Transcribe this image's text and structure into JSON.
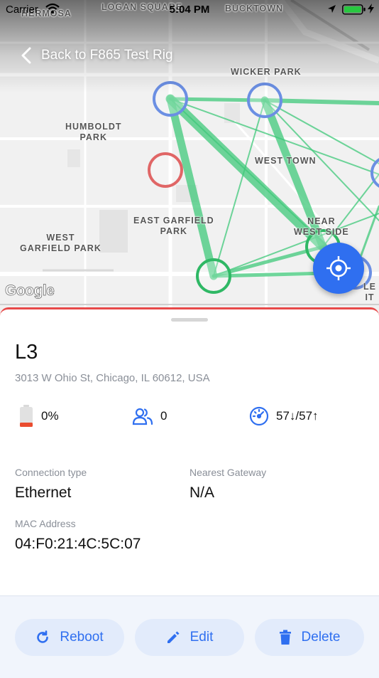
{
  "status_bar": {
    "carrier": "Carrier",
    "time": "5:04 PM"
  },
  "nav": {
    "back_label": "Back to F865 Test Rig"
  },
  "map": {
    "labels": {
      "hermosa": "HERMOSA",
      "logan_square": "LOGAN SQUARE",
      "bucktown": "BUCKTOWN",
      "wicker_park": "WICKER PARK",
      "humboldt_park": "HUMBOLDT\nPARK",
      "west_town": "WEST TOWN",
      "east_garfield_park": "EAST GARFIELD\nPARK",
      "west_garfield_park": "WEST\nGARFIELD PARK",
      "near_west_side": "NEAR\nWEST SIDE",
      "partial": "LE IT"
    },
    "attribution": "Google",
    "colors": {
      "link": "#3fc87a",
      "node_online": "#2fb865",
      "node_selected": "#6b8fe3",
      "node_offline": "#e06666"
    }
  },
  "device": {
    "name": "L3",
    "address": "3013 W Ohio St, Chicago, IL 60612, USA",
    "battery": "0%",
    "clients": "0",
    "speed": "57↓/57↑",
    "connection_type_label": "Connection type",
    "connection_type": "Ethernet",
    "nearest_gateway_label": "Nearest Gateway",
    "nearest_gateway": "N/A",
    "mac_label": "MAC Address",
    "mac": "04:F0:21:4C:5C:07"
  },
  "actions": {
    "reboot": "Reboot",
    "edit": "Edit",
    "delete": "Delete"
  },
  "colors": {
    "accent": "#2f6ff0",
    "alert": "#e84a4a"
  }
}
